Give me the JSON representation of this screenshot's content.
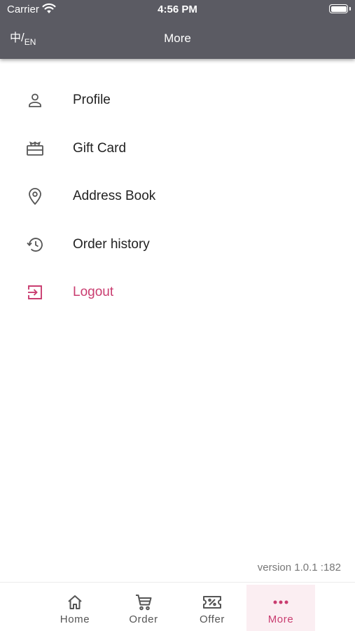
{
  "status_bar": {
    "carrier": "Carrier",
    "time": "4:56 PM"
  },
  "header": {
    "lang_toggle": {
      "zh": "中",
      "slash": "/",
      "en": "EN"
    },
    "title": "More"
  },
  "menu": {
    "items": [
      {
        "label": "Profile",
        "icon": "person-icon"
      },
      {
        "label": "Gift Card",
        "icon": "gift-card-icon"
      },
      {
        "label": "Address Book",
        "icon": "location-pin-icon"
      },
      {
        "label": "Order history",
        "icon": "history-icon"
      },
      {
        "label": "Logout",
        "icon": "logout-icon"
      }
    ]
  },
  "version": "version 1.0.1  :182",
  "tabbar": {
    "tabs": [
      {
        "label": "Home",
        "icon": "home-icon"
      },
      {
        "label": "Order",
        "icon": "cart-icon"
      },
      {
        "label": "Offer",
        "icon": "coupon-icon"
      },
      {
        "label": "More",
        "icon": "more-dots-icon",
        "active": true
      }
    ]
  },
  "colors": {
    "header_bg": "#5b5b63",
    "accent": "#c93d70",
    "active_tab_bg": "#fbeef2",
    "text": "#222222",
    "icon": "#555555"
  }
}
